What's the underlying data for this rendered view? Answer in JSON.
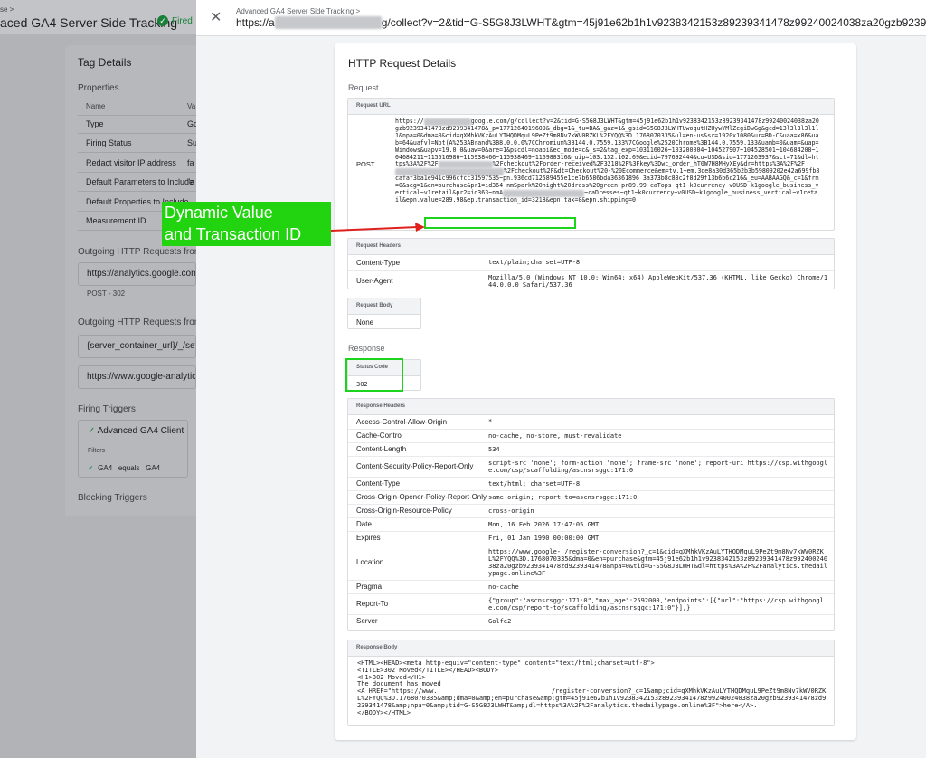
{
  "bg": {
    "crumb": "se >",
    "title": "aced GA4 Server Side Tracking",
    "fired": "Fired",
    "tag_details": "Tag Details",
    "properties": "Properties",
    "col_name": "Name",
    "col_value": "Va",
    "rows": [
      {
        "name": "Type",
        "value": "Go"
      },
      {
        "name": "Firing Status",
        "value": "Su"
      },
      {
        "name": "Redact visitor IP address",
        "value": "fa"
      },
      {
        "name": "Default Parameters to Include",
        "value": "\"a"
      },
      {
        "name": "Default Properties to Include",
        "value": ""
      },
      {
        "name": "Measurement ID",
        "value": "G"
      }
    ],
    "outgoing1": "Outgoing HTTP Requests from S",
    "outgoing1_url": "https://analytics.google.com/",
    "outgoing1_status": "POST - 302",
    "outgoing2": "Outgoing HTTP Requests from E",
    "outgoing2_url1": "{server_container_url}/_/set_...",
    "outgoing2_url2": "https://www.google-analytic...",
    "firing_triggers": "Firing Triggers",
    "trigger": "Advanced GA4 Client",
    "filters": "Filters",
    "filter_a": "GA4",
    "filter_op": "equals",
    "filter_b": "GA4",
    "blocking_triggers": "Blocking Triggers"
  },
  "panel": {
    "crumb": "Advanced GA4 Server Side Tracking >",
    "url_start": "https://a",
    "url_end": "g/collect?v=2&tid=G-S5G8J3LWHT&gtm=45j91e62b1h1v9238342153z89239341478z99240024038za20gzb9239",
    "title": "HTTP Request Details",
    "request_section": "Request",
    "request_url_head": "Request URL",
    "method": "POST",
    "request_url_a": "https://",
    "request_url_b": "google.com/g/collect?v=2&tid=G-S5G8J3LWHT&gtm=45j91e62b1h1v9238342153z89239341478z99240024038za20gzb9239341478zd9239341478&_p=1771264019609&_dbg=1&_tu=BA&_gaz=1&_gsid=S5G8J3LWHTUwoqutHZUywYMlZcgiDwGg&gcd=13l3l3l3l1l1&npa=0&dma=0&cid=qXMhkVKzAuLYTHQDMquL9PeZt9m8Nv7kWV0RZKL%2FYQQ%3D.1768070335&ul=en-us&sr=1920x1080&ur=BD-C&uaa=x86&uab=64&uafvl=Not(A%253ABrand%3B8.0.0.0%7CChromium%3B144.0.7559.133%7CGoogle%2520Chrome%3B144.0.7559.133&uamb=0&uam=&uap=Windows&uapv=19.0.0&uaw=0&are=1&pscdl=noapi&ec_mode=c&_s=2&tag_exp=103116026~103200004~104527907~104528501~104684208~104684211~115616986~115938466~115938469~116988316&_uip=103.152.102.69&ecid=797692444&cu=USD&sid=1771263937&sct=71&dl=https%3A%2F%2F",
    "request_url_c": "%2Fcheckout%2Forder-received%2F3218%2F%3Fkey%3Dwc_order_hT0W7H8MHyXEy&dr=https%3A%2F%2F",
    "request_url_d": "%2Fcheckout%2F&dt=Checkout%20-%20Ecommerce&em=tv.1~em.3de8a30d365b2b3b59809202e42a699fb8cafaf3ba1e941c996cfcc31597535~pn.936cd712589455e1ce7b6586bda36361896 3a373b8c83c2f8d29f13b6b6c216&_eu=AABAAGQ&_c=1&frm=0&seg=1&en=purchase&pr1=id364~nmSpark%20night%20dress%20green~pr89.99~caTops~qt1~k0currency~v0USD~k1google_business_vertical~v1retail&pr2=id363~nmA",
    "request_url_e": "~caDresses~qt1~k0currency~v0USD~k1google_business_vertical~v1retail&",
    "request_url_hl": "epn.value=289.98&ep.transaction_id=3218&",
    "request_url_f": "epn.tax=0&epn.shipping=0",
    "request_headers_head": "Request Headers",
    "request_headers": [
      {
        "k": "Content-Type",
        "v": "text/plain;charset=UTF-8"
      },
      {
        "k": "User-Agent",
        "v": "Mozilla/5.0 (Windows NT 10.0; Win64; x64) AppleWebKit/537.36 (KHTML, like Gecko) Chrome/144.0.0.0 Safari/537.36"
      }
    ],
    "request_body_head": "Request Body",
    "request_body": "None",
    "response_section": "Response",
    "status_code_head": "Status Code",
    "status_code": "302",
    "response_headers_head": "Response Headers",
    "response_headers": [
      {
        "k": "Access-Control-Allow-Origin",
        "v": "*"
      },
      {
        "k": "Cache-Control",
        "v": "no-cache, no-store, must-revalidate"
      },
      {
        "k": "Content-Length",
        "v": "534"
      },
      {
        "k": "Content-Security-Policy-Report-Only",
        "v": "script-src 'none'; form-action 'none'; frame-src 'none'; report-uri https://csp.withgoogle.com/csp/scaffolding/ascnsrsggc:171:0"
      },
      {
        "k": "Content-Type",
        "v": "text/html; charset=UTF-8"
      },
      {
        "k": "Cross-Origin-Opener-Policy-Report-Only",
        "v": "same-origin; report-to=ascnsrsggc:171:0"
      },
      {
        "k": "Cross-Origin-Resource-Policy",
        "v": "cross-origin"
      },
      {
        "k": "Date",
        "v": "Mon, 16 Feb 2026 17:47:05 GMT"
      },
      {
        "k": "Expires",
        "v": "Fri, 01 Jan 1990 00:00:00 GMT"
      },
      {
        "k": "Location",
        "v": "https://www.google-                        /register-conversion?_c=1&cid=qXMhkVKzAuLYTHQDMquL9PeZt9m8Nv7kWV0RZKL%2FYQQ%3D.1768070335&dma=0&en=purchase&gtm=45j91e62b1h1v9238342153z89239341478z99240024038za20gzb9239341478zd9239341478&npa=0&tid=G-S5G8J3LWHT&dl=https%3A%2F%2Fanalytics.thedailypage.online%3F"
      },
      {
        "k": "Pragma",
        "v": "no-cache"
      },
      {
        "k": "Report-To",
        "v": "{\"group\":\"ascnsrsggc:171:0\",\"max_age\":2592000,\"endpoints\":[{\"url\":\"https://csp.withgoogle.com/csp/report-to/scaffolding/ascnsrsggc:171:0\"}],}"
      },
      {
        "k": "Server",
        "v": "Golfe2"
      }
    ],
    "response_body_head": "Response Body",
    "response_body": "<HTML><HEAD><meta http-equiv=\"content-type\" content=\"text/html;charset=utf-8\">\n<TITLE>302 Moved</TITLE></HEAD><BODY>\n<H1>302 Moved</H1>\nThe document has moved\n<A HREF=\"https://www.                              /register-conversion?_c=1&amp;cid=qXMhkVKzAuLYTHQDMquL9PeZt9m8Nv7kWV0RZKL%2FYQQ%3D.1768070335&amp;dma=0&amp;en=purchase&amp;gtm=45j91e62b1h1v9238342153z89239341478z99240024038za20gzb9239341478zd9239341478&amp;npa=0&amp;tid=G-S5G8J3LWHT&amp;dl=https%3A%2F%2Fanalytics.thedailypage.online%3F\">here</A>.\n</BODY></HTML>"
  },
  "annotation": {
    "line1": "Dynamic Value",
    "line2": "and Transaction ID"
  }
}
